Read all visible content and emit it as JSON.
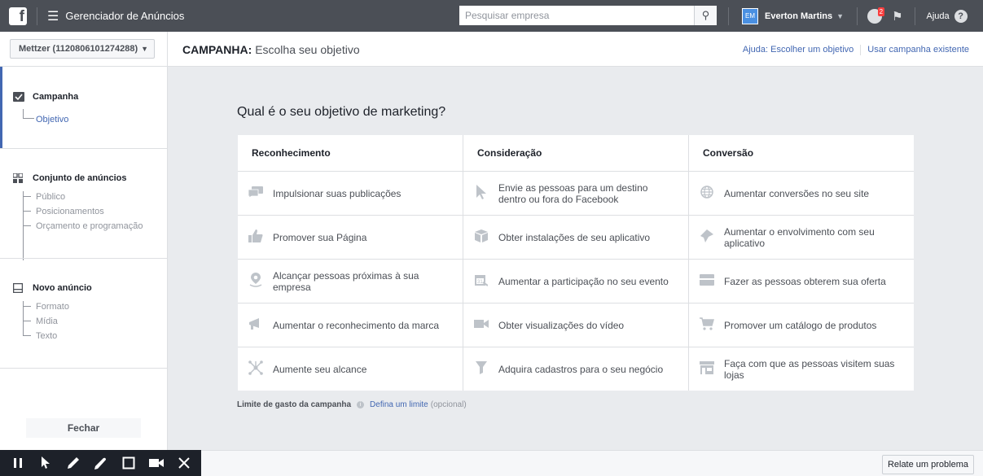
{
  "topbar": {
    "app_title": "Gerenciador de Anúncios",
    "search_placeholder": "Pesquisar empresa",
    "avatar_initials": "EM",
    "user_name": "Everton Martins",
    "notification_count": "2",
    "help_label": "Ajuda"
  },
  "sidebar": {
    "account": "Mettzer (1120806101274288)",
    "sections": [
      {
        "title": "Campanha",
        "items": [
          "Objetivo"
        ]
      },
      {
        "title": "Conjunto de anúncios",
        "items": [
          "Público",
          "Posicionamentos",
          "Orçamento e programação"
        ]
      },
      {
        "title": "Novo anúncio",
        "items": [
          "Formato",
          "Mídia",
          "Texto"
        ]
      }
    ],
    "close_label": "Fechar"
  },
  "header": {
    "title_prefix": "CAMPANHA:",
    "title_rest": "Escolha seu objetivo",
    "link_help": "Ajuda: Escolher um objetivo",
    "link_existing": "Usar campanha existente"
  },
  "main": {
    "question": "Qual é o seu objetivo de marketing?",
    "columns": [
      {
        "title": "Reconhecimento",
        "options": [
          "Impulsionar suas publicações",
          "Promover sua Página",
          "Alcançar pessoas próximas à sua empresa",
          "Aumentar o reconhecimento da marca",
          "Aumente seu alcance"
        ]
      },
      {
        "title": "Consideração",
        "options": [
          "Envie as pessoas para um destino dentro ou fora do Facebook",
          "Obter instalações de seu aplicativo",
          "Aumentar a participação no seu evento",
          "Obter visualizações do vídeo",
          "Adquira cadastros para o seu negócio"
        ]
      },
      {
        "title": "Conversão",
        "options": [
          "Aumentar conversões no seu site",
          "Aumentar o envolvimento com seu aplicativo",
          "Fazer as pessoas obterem sua oferta",
          "Promover um catálogo de produtos",
          "Faça com que as pessoas visitem suas lojas"
        ]
      }
    ],
    "limit_label": "Limite de gasto da campanha",
    "limit_link": "Defina um limite",
    "limit_optional": "(opcional)"
  },
  "bottom": {
    "report_label": "Relate um problema"
  }
}
